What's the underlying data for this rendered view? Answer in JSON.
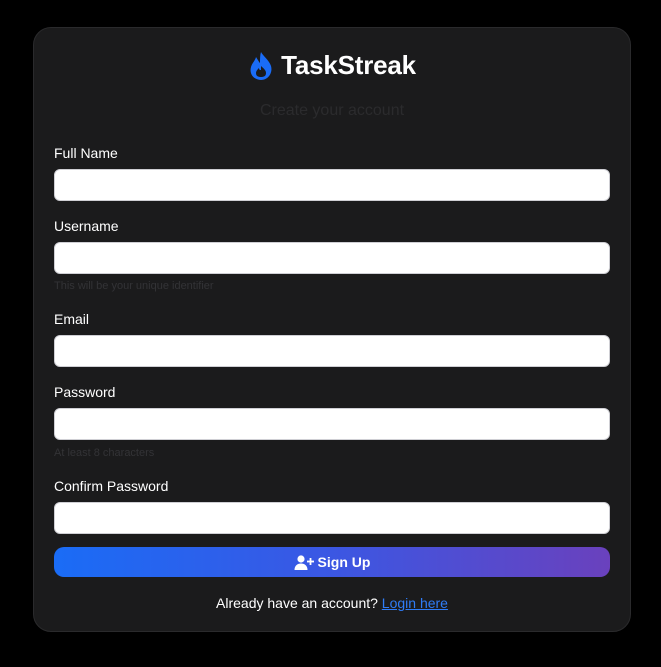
{
  "brand": {
    "name": "TaskStreak",
    "icon": "flame-icon",
    "color": "#1a6cf6"
  },
  "subtitle": "Create your account",
  "form": {
    "full_name": {
      "label": "Full Name",
      "value": "",
      "placeholder": ""
    },
    "username": {
      "label": "Username",
      "value": "",
      "placeholder": "",
      "hint": "This will be your unique identifier"
    },
    "email": {
      "label": "Email",
      "value": "",
      "placeholder": ""
    },
    "password": {
      "label": "Password",
      "value": "",
      "placeholder": "",
      "hint": "At least 8 characters"
    },
    "confirm_password": {
      "label": "Confirm Password",
      "value": "",
      "placeholder": ""
    }
  },
  "submit": {
    "label": "Sign Up",
    "icon": "user-plus-icon",
    "gradient": [
      "#1a6cf6",
      "#6a41bd"
    ]
  },
  "footer": {
    "text": "Already have an account?",
    "link_label": "Login here",
    "link_color": "#2f7cf6"
  }
}
